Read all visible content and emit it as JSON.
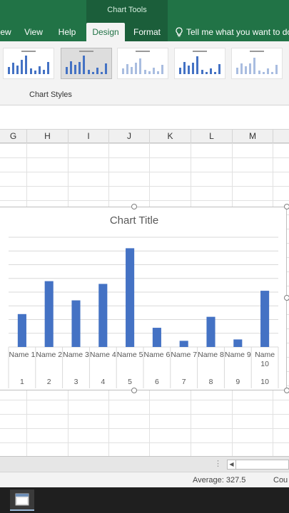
{
  "ribbon": {
    "contextual_group": "Chart Tools",
    "tabs": [
      {
        "label": "ew",
        "active": false
      },
      {
        "label": "View",
        "active": false
      },
      {
        "label": "Help",
        "active": false
      },
      {
        "label": "Design",
        "active": true
      },
      {
        "label": "Format",
        "active": false
      }
    ],
    "tell_me": "Tell me what you want to do",
    "group_label": "Chart Styles"
  },
  "columns": [
    "G",
    "H",
    "I",
    "J",
    "K",
    "L",
    "M"
  ],
  "chart_data": {
    "type": "bar",
    "title": "Chart Title",
    "categories": [
      "Name 1",
      "Name 2",
      "Name 3",
      "Name 4",
      "Name 5",
      "Name 6",
      "Name 7",
      "Name 8",
      "Name 9",
      "Name 10"
    ],
    "sub_categories": [
      "1",
      "2",
      "3",
      "4",
      "5",
      "6",
      "7",
      "8",
      "9",
      "10"
    ],
    "values": [
      240,
      480,
      340,
      460,
      720,
      140,
      45,
      220,
      55,
      410
    ],
    "ylim": [
      0,
      800
    ],
    "grid": true,
    "colors": {
      "bar": "#4472c4",
      "gridline": "#d9d9d9",
      "axis_text": "#595959"
    }
  },
  "statusbar": {
    "average": "Average: 327.5",
    "count": "Cou"
  },
  "icons": {
    "tell_me": "lightbulb-icon",
    "taskbar_app": "window-icon"
  },
  "colors": {
    "accent": "#217346"
  }
}
